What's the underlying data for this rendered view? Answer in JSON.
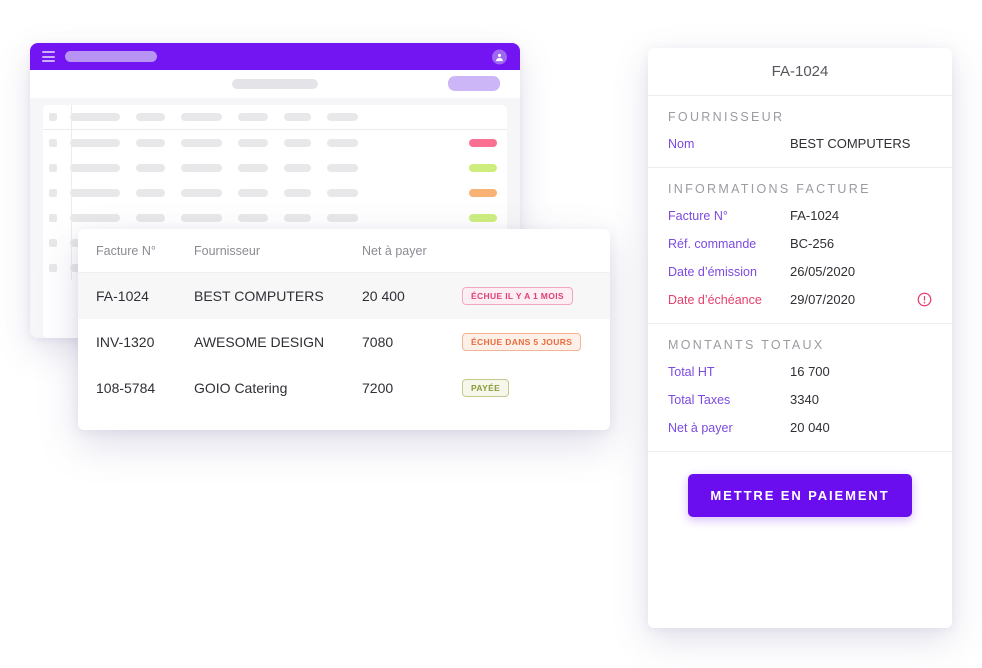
{
  "background_window": {
    "topbar": {
      "menu_icon": "hamburger-icon",
      "search_placeholder_skeleton": "",
      "avatar_icon": "user-avatar-icon"
    },
    "toolbar": {
      "filter_skeleton": "",
      "action_button_skeleton": ""
    },
    "skeleton_table": {
      "header_cells": [
        150,
        90,
        125,
        90,
        80,
        95
      ],
      "rows": [
        {
          "cells": [
            150,
            90,
            125,
            90,
            80,
            95
          ],
          "pill_color": "#fb6f92"
        },
        {
          "cells": [
            150,
            90,
            125,
            90,
            80,
            95
          ],
          "pill_color": "#cdee7f"
        },
        {
          "cells": [
            150,
            90,
            125,
            90,
            80,
            95
          ],
          "pill_color": "#f8b274"
        },
        {
          "cells": [
            150,
            90,
            125,
            90,
            80,
            95
          ],
          "pill_color": "#cdee7f"
        },
        {
          "cells": [
            150,
            90,
            125,
            90,
            80,
            95
          ],
          "pill_color": ""
        },
        {
          "cells": [
            150,
            90,
            125,
            90,
            80,
            95
          ],
          "pill_color": ""
        }
      ]
    }
  },
  "invoice_table": {
    "columns": [
      "Facture N°",
      "Fournisseur",
      "Net à payer",
      ""
    ],
    "rows": [
      {
        "number": "FA-1024",
        "supplier": "BEST COMPUTERS",
        "net": "20 400",
        "status_label": "ÉCHUE IL Y A 1 MOIS",
        "status_kind": "overdue",
        "selected": true
      },
      {
        "number": "INV-1320",
        "supplier": "AWESOME DESIGN",
        "net": "7080",
        "status_label": "ÉCHUE DANS 5 JOURS",
        "status_kind": "duesoon",
        "selected": false
      },
      {
        "number": "108-5784",
        "supplier": "GOIO Catering",
        "net": "7200",
        "status_label": "PAYÉE",
        "status_kind": "paid",
        "selected": false
      }
    ]
  },
  "detail_panel": {
    "title": "FA-1024",
    "sections": [
      {
        "heading": "FOURNISSEUR",
        "fields": [
          {
            "label": "Nom",
            "value": "BEST COMPUTERS",
            "alert": false
          }
        ]
      },
      {
        "heading": "INFORMATIONS FACTURE",
        "fields": [
          {
            "label": "Facture N°",
            "value": "FA-1024",
            "alert": false
          },
          {
            "label": "Réf. commande",
            "value": "BC-256",
            "alert": false
          },
          {
            "label": "Date d’émission",
            "value": "26/05/2020",
            "alert": false
          },
          {
            "label": "Date d’échéance",
            "value": "29/07/2020",
            "alert": true,
            "alert_icon": "exclamation-circle-icon"
          }
        ]
      },
      {
        "heading": "MONTANTS TOTAUX",
        "fields": [
          {
            "label": "Total HT",
            "value": "16 700",
            "alert": false
          },
          {
            "label": "Total Taxes",
            "value": "3340",
            "alert": false
          },
          {
            "label": "Net à payer",
            "value": "20 040",
            "alert": false
          }
        ]
      }
    ],
    "primary_action": "METTRE EN PAIEMENT"
  },
  "colors": {
    "brand_purple": "#6a0ef0",
    "topbar_purple": "#7215f2",
    "label_purple": "#7c4ae0",
    "overdue_red": "#e0407a",
    "duesoon_orange": "#ec6b3e",
    "paid_green": "#8a9a3a",
    "alert_pink": "#e63f6d"
  }
}
